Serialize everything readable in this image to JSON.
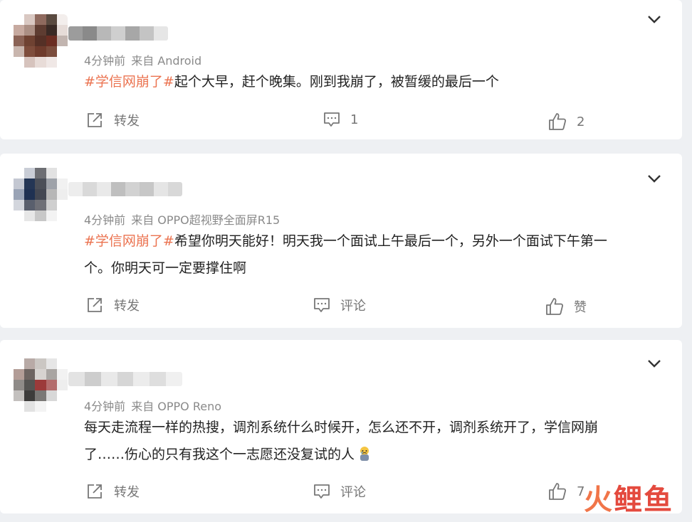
{
  "comments": [
    {
      "time": "4分钟前",
      "source": "来自 Android",
      "topic": "#学信网崩了#",
      "body_line1": "起个大早，赶个晚集。刚到我崩了，被暂缓的最后一个",
      "body_line2": "",
      "repost_label": "转发",
      "comment_label": "1",
      "like_label": "2"
    },
    {
      "time": "4分钟前",
      "source": "来自 OPPO超视野全面屏R15",
      "topic": "#学信网崩了#",
      "body_line1": "希望你明天能好！明天我一个面试上午最后一个，另外一个面试下午第一",
      "body_line2": "个。你明天可一定要撑住啊",
      "repost_label": "转发",
      "comment_label": "评论",
      "like_label": "赞"
    },
    {
      "time": "4分钟前",
      "source": "来自 OPPO Reno",
      "topic": "",
      "body_line1": "每天走流程一样的热搜，调剂系统什么时候开，怎么还不开，调剂系统开了，学信网崩",
      "body_line2": "了……伤心的只有我这个一志愿还没复试的人",
      "repost_label": "转发",
      "comment_label": "评论",
      "like_label": "7"
    }
  ],
  "icons": {
    "more": "chevron-down-icon",
    "repost": "share-icon",
    "comment": "comment-icon",
    "like": "thumbs-up-icon",
    "emoji": "crying-emoji-icon"
  },
  "colors": {
    "topic": "#eb7350",
    "meta": "#8a8a8a",
    "background": "#eef0f3",
    "watermark": "#e23b2e"
  },
  "watermark": {
    "fire": "火",
    "text": "鲤鱼"
  }
}
